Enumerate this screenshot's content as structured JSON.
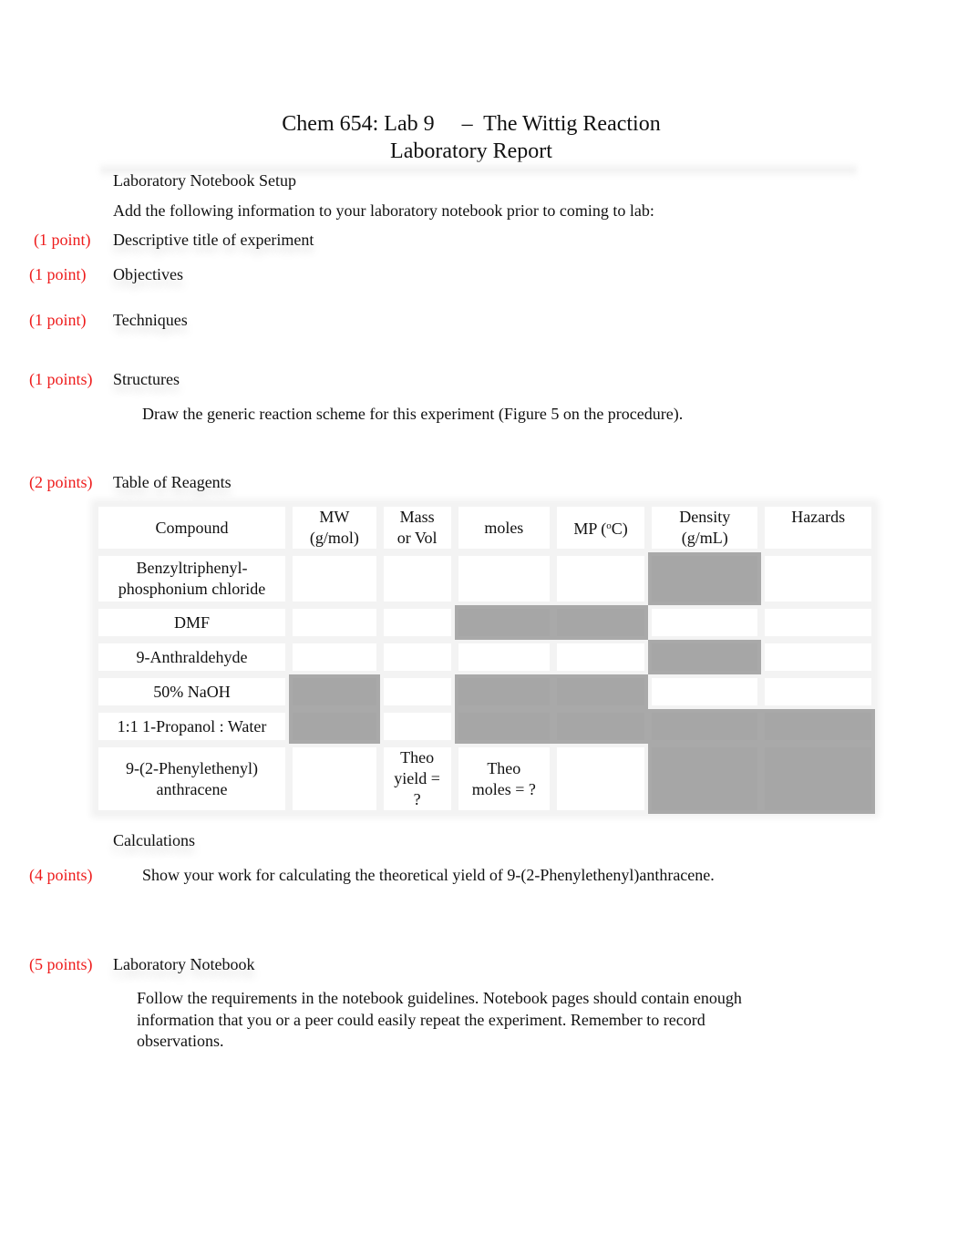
{
  "header": {
    "title_line1_left": "Chem 654: Lab 9",
    "title_dash": "–",
    "title_line1_right": "The Wittig Reaction",
    "title_line2": "Laboratory Report"
  },
  "setup": {
    "heading": "Laboratory Notebook Setup",
    "instruction": "Add the following information to your laboratory notebook prior to coming to lab:"
  },
  "items": [
    {
      "points": "(1 point)",
      "label": "Descriptive title of experiment"
    },
    {
      "points": "(1 point)",
      "label": "Objectives"
    },
    {
      "points": "(1 point)",
      "label": "Techniques"
    },
    {
      "points": "(1 points)",
      "label": "Structures",
      "note": "Draw the generic reaction scheme for this experiment (Figure 5 on the procedure)."
    },
    {
      "points": "(2 points)",
      "label": "Table of Reagents"
    }
  ],
  "table": {
    "headers": {
      "compound": "Compound",
      "mw_line1": "MW",
      "mw_line2": "(g/mol)",
      "mass_line1": "Mass",
      "mass_line2": "or Vol",
      "moles": "moles",
      "mp_prefix": "MP (",
      "mp_degree": "o",
      "mp_suffix": "C)",
      "density_line1": "Density",
      "density_line2": "(g/mL)",
      "hazards": "Hazards"
    },
    "rows": [
      {
        "compound_line1": "Benzyltriphenyl-",
        "compound_line2": "phosphonium chloride",
        "shaded": [
          "density"
        ]
      },
      {
        "compound_line1": "DMF",
        "shaded": [
          "moles",
          "mp"
        ]
      },
      {
        "compound_line1": "9-Anthraldehyde",
        "shaded": [
          "density"
        ]
      },
      {
        "compound_line1": "50% NaOH",
        "shaded": [
          "mw",
          "moles",
          "mp"
        ]
      },
      {
        "compound_line1": "1:1 1-Propanol : Water",
        "shaded": [
          "mw",
          "moles",
          "mp",
          "density",
          "hazards"
        ]
      },
      {
        "compound_line1": "9-(2-Phenylethenyl)",
        "compound_line2": "anthracene",
        "shaded": [
          "density",
          "hazards"
        ],
        "mass_line1": "Theo",
        "mass_line2": "yield =",
        "mass_line3": "?",
        "moles_line1": "Theo",
        "moles_line2": "moles = ?"
      }
    ]
  },
  "calculations": {
    "heading": "Calculations",
    "points": "(4 points)",
    "text": "Show your work for calculating the theoretical yield of 9-(2-Phenylethenyl)anthracene."
  },
  "notebook": {
    "points": "(5 points)",
    "heading": "Laboratory Notebook",
    "text": "Follow the requirements in the notebook guidelines. Notebook pages should contain enough information that you or a peer could easily repeat the experiment. Remember to record observations."
  },
  "colors": {
    "points_red": "#ee1c1c",
    "shaded_cell": "#a6a6a6"
  }
}
